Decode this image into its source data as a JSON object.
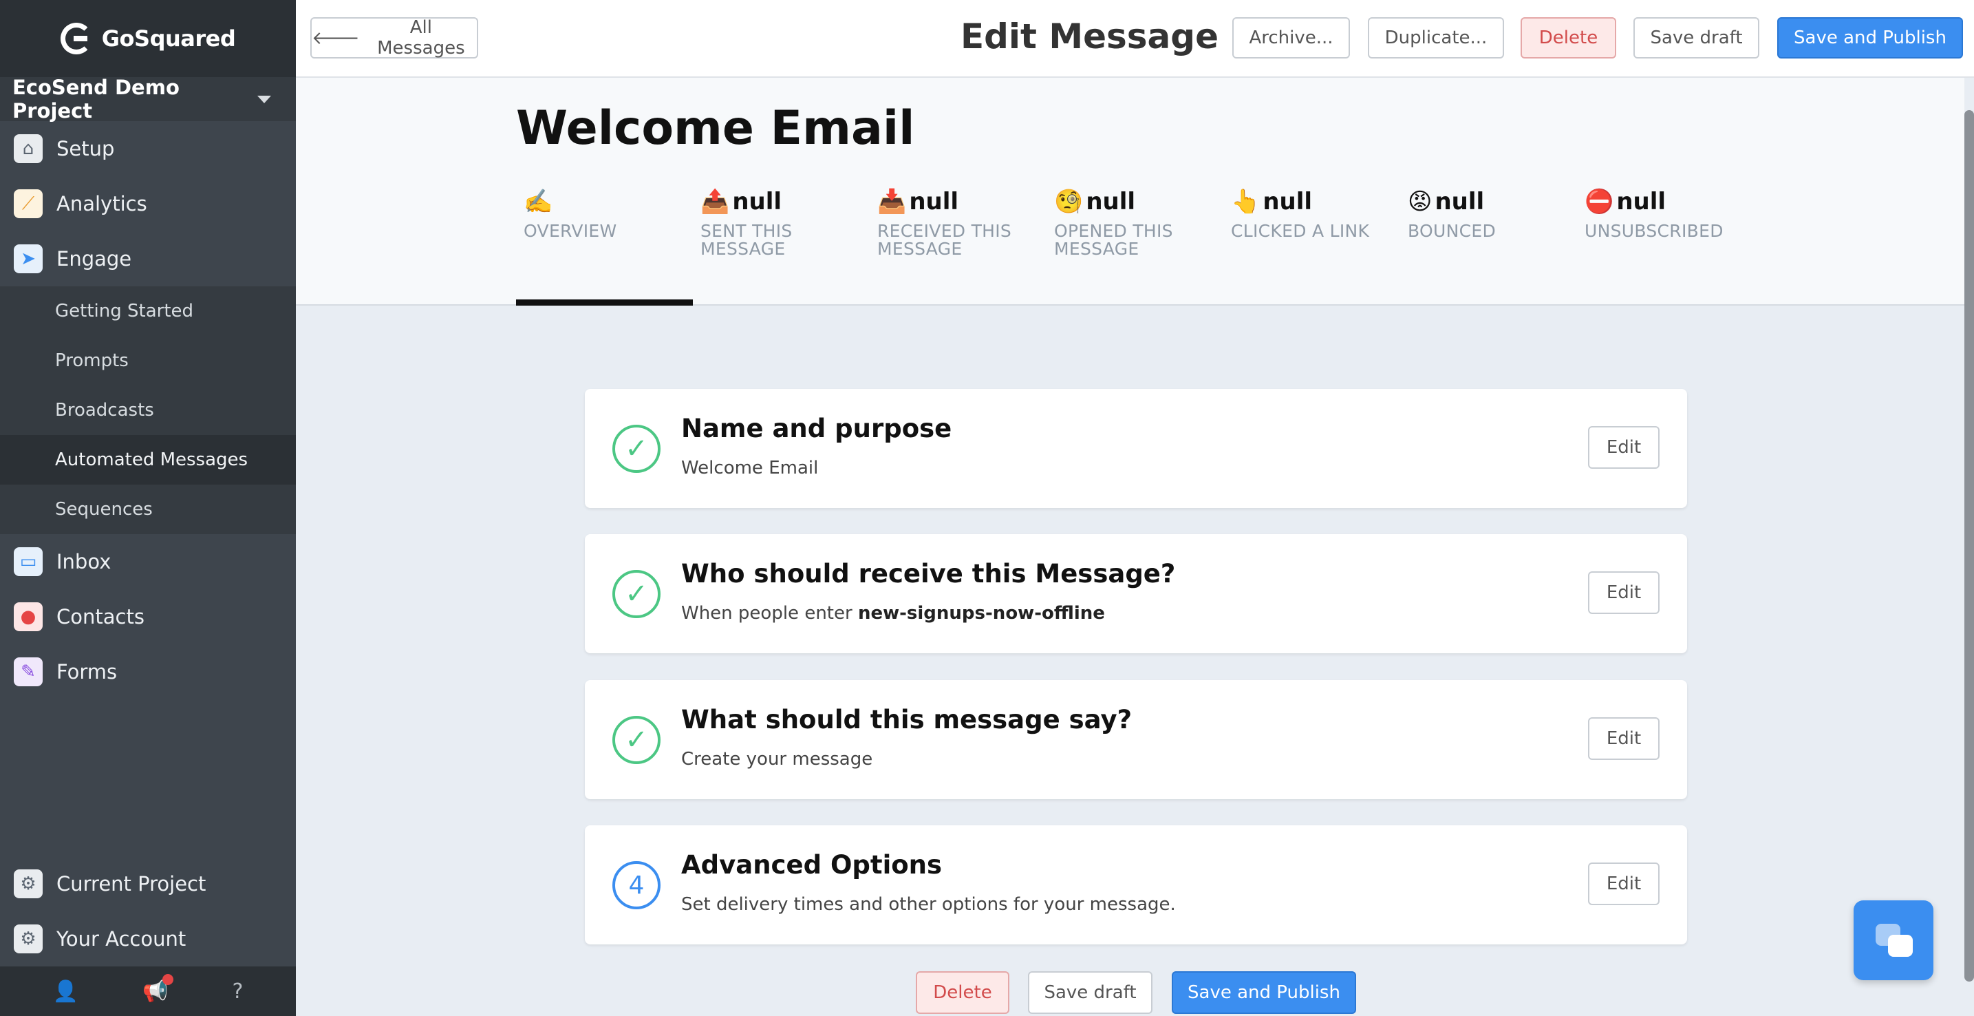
{
  "sidebar": {
    "brand": "GoSquared",
    "project": "EcoSend Demo Project",
    "nav": [
      {
        "label": "Setup",
        "icon": "home-icon"
      },
      {
        "label": "Analytics",
        "icon": "chart-icon"
      },
      {
        "label": "Engage",
        "icon": "send-icon"
      }
    ],
    "engage_items": [
      "Getting Started",
      "Prompts",
      "Broadcasts",
      "Automated Messages",
      "Sequences"
    ],
    "nav2": [
      {
        "label": "Inbox",
        "icon": "inbox-icon"
      },
      {
        "label": "Contacts",
        "icon": "contact-icon"
      },
      {
        "label": "Forms",
        "icon": "pencil-icon"
      }
    ],
    "bottom_nav": [
      {
        "label": "Current Project",
        "icon": "gear-icon"
      },
      {
        "label": "Your Account",
        "icon": "gear-icon"
      }
    ]
  },
  "topbar": {
    "back_label": "All Messages",
    "title": "Edit Message",
    "archive_label": "Archive...",
    "duplicate_label": "Duplicate...",
    "delete_label": "Delete",
    "save_draft_label": "Save draft",
    "publish_label": "Save and Publish"
  },
  "header": {
    "message_title": "Welcome Email",
    "tabs": [
      {
        "emoji": "✍️",
        "value": "",
        "label": "OVERVIEW"
      },
      {
        "emoji": "📤",
        "value": "null",
        "label": "SENT THIS MESSAGE"
      },
      {
        "emoji": "📥",
        "value": "null",
        "label": "RECEIVED THIS MESSAGE"
      },
      {
        "emoji": "🧐",
        "value": "null",
        "label": "OPENED THIS MESSAGE"
      },
      {
        "emoji": "👆",
        "value": "null",
        "label": "CLICKED A LINK"
      },
      {
        "emoji": "😡",
        "value": "null",
        "label": "BOUNCED"
      },
      {
        "emoji": "⛔",
        "value": "null",
        "label": "UNSUBSCRIBED"
      }
    ]
  },
  "steps": [
    {
      "status": "done",
      "title": "Name and purpose",
      "subtitle": "Welcome Email",
      "edit": "Edit"
    },
    {
      "status": "done",
      "title": "Who should receive this Message?",
      "subtitle_prefix": "When people enter ",
      "subtitle_bold": "new-signups-now-offline",
      "edit": "Edit"
    },
    {
      "status": "done",
      "title": "What should this message say?",
      "subtitle": "Create your message",
      "edit": "Edit"
    },
    {
      "status": "todo",
      "number": "4",
      "title": "Advanced Options",
      "subtitle": "Set delivery times and other options for your message.",
      "edit": "Edit"
    }
  ],
  "footer": {
    "delete_label": "Delete",
    "save_draft_label": "Save draft",
    "publish_label": "Save and Publish"
  },
  "colors": {
    "sidebar": "#3e454d",
    "primary": "#3b8ef0",
    "success": "#4cc784",
    "danger": "#d24b4b"
  }
}
